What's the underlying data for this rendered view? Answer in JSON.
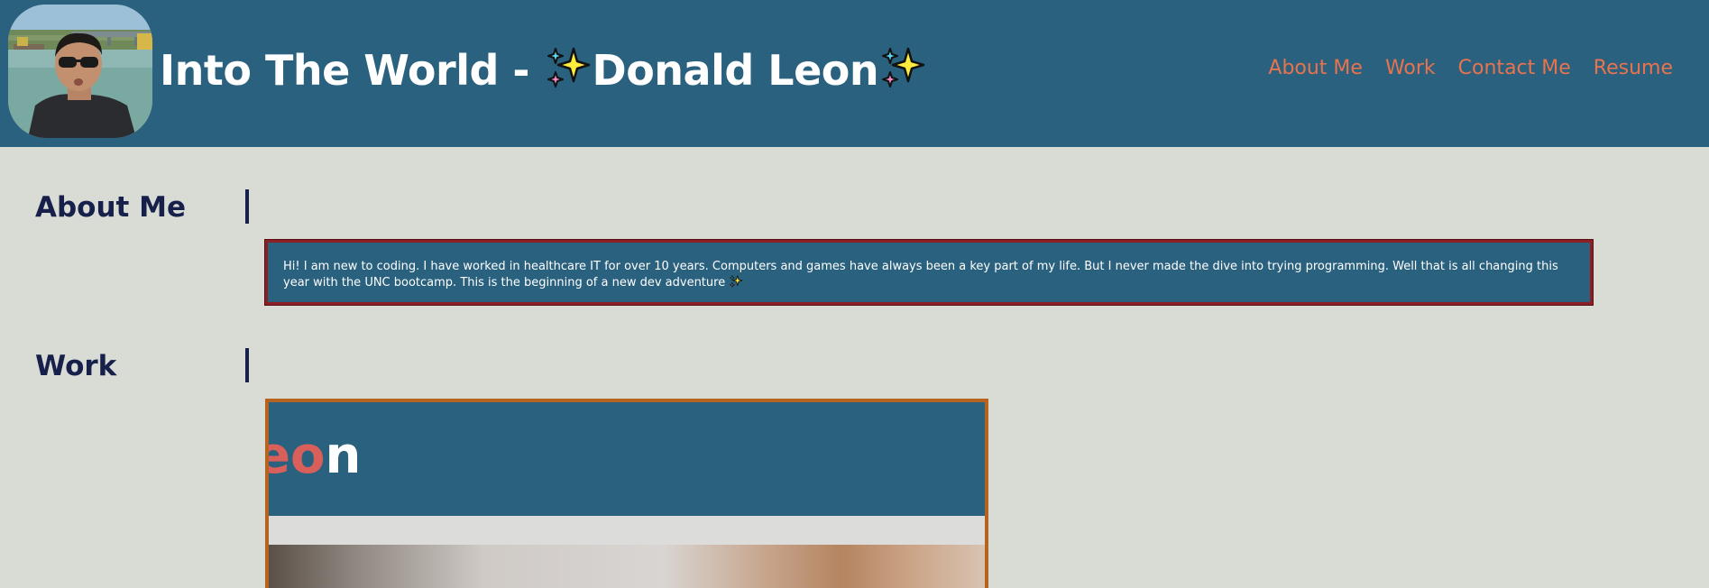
{
  "header": {
    "title_prefix": "Into The World - ",
    "title_name": "Donald Leon",
    "avatar_alt": "profile-photo",
    "colors": {
      "background": "#2a617e",
      "title": "#ffffff",
      "nav": "#e8734f"
    },
    "nav": [
      {
        "label": "About Me"
      },
      {
        "label": "Work"
      },
      {
        "label": "Contact Me"
      },
      {
        "label": "Resume"
      }
    ]
  },
  "about": {
    "heading": "About Me",
    "text": "Hi! I am new to coding. I have worked in healthcare IT for over 10 years. Computers and games have always been a key part of my life. But I never made the dive into trying programming. Well that is all changing this year with the UNC bootcamp. This is the beginning of a new dev adventure"
  },
  "work": {
    "heading": "Work",
    "preview_text_pink": "eo",
    "preview_text_white": "n"
  },
  "colors": {
    "page_background": "#d9dbd5",
    "heading": "#16204a",
    "about_border": "#8c1f25",
    "work_border": "#b5631f"
  },
  "icons": {
    "sparkles": "sparkles-icon"
  }
}
